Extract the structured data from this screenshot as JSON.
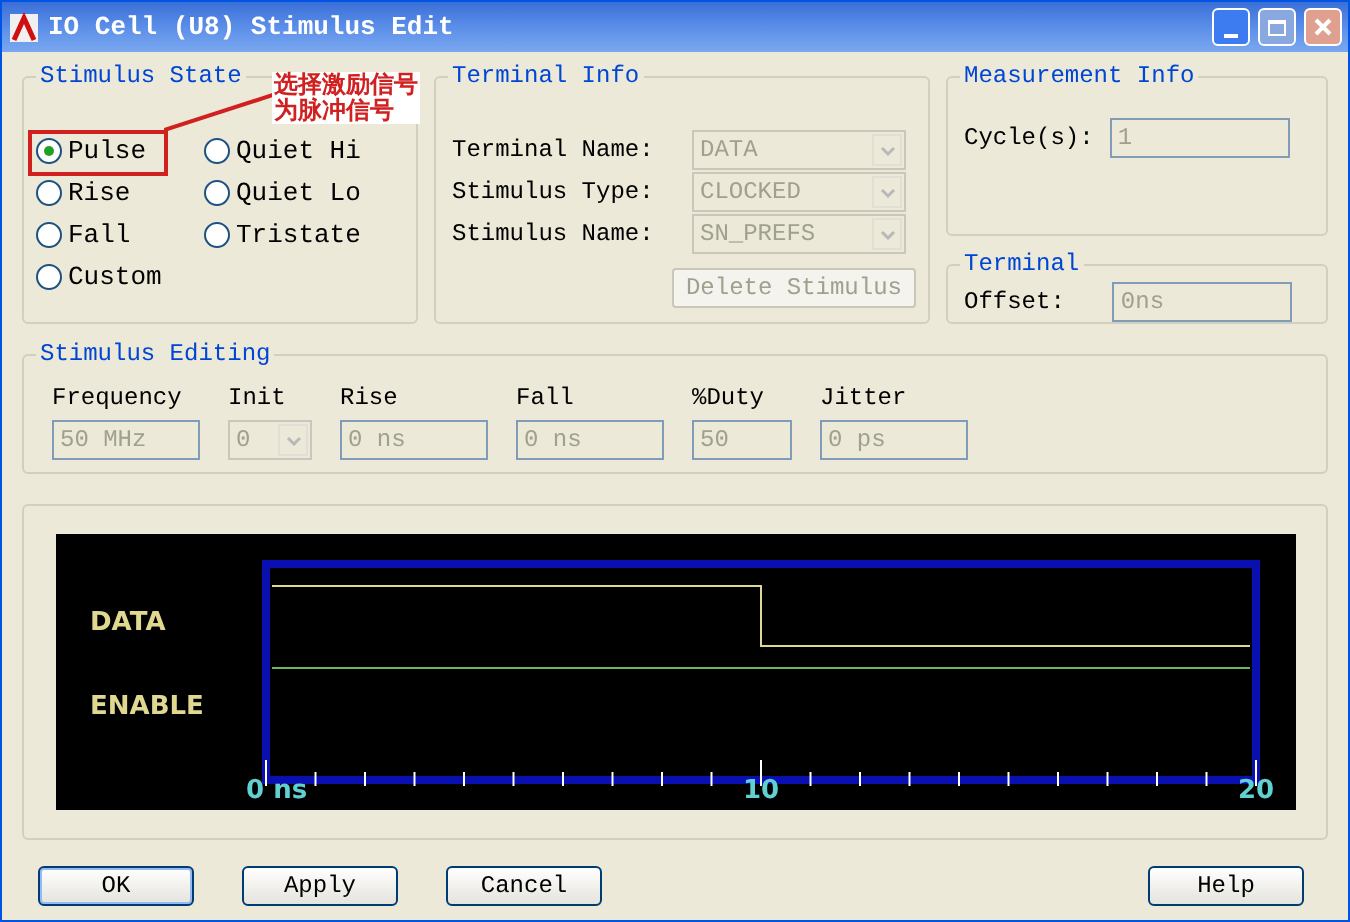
{
  "window": {
    "title": "IO Cell (U8) Stimulus Edit"
  },
  "stimulus_state": {
    "legend": "Stimulus State",
    "options": [
      {
        "label": "Pulse",
        "selected": true
      },
      {
        "label": "Quiet Hi",
        "selected": false
      },
      {
        "label": "Rise",
        "selected": false
      },
      {
        "label": "Quiet Lo",
        "selected": false
      },
      {
        "label": "Fall",
        "selected": false
      },
      {
        "label": "Tristate",
        "selected": false
      },
      {
        "label": "Custom",
        "selected": false
      }
    ]
  },
  "annotation": {
    "lines": [
      "选择激励信号",
      "为脉冲信号"
    ]
  },
  "terminal_info": {
    "legend": "Terminal Info",
    "fields": [
      {
        "label": "Terminal Name:",
        "value": "DATA"
      },
      {
        "label": "Stimulus Type:",
        "value": "CLOCKED"
      },
      {
        "label": "Stimulus Name:",
        "value": "SN_PREFS"
      }
    ],
    "delete_button": {
      "label": "Delete Stimulus",
      "disabled": true
    }
  },
  "measurement_info": {
    "legend": "Measurement Info",
    "field": {
      "label": "Cycle(s):",
      "value": "1"
    }
  },
  "terminal": {
    "legend": "Terminal",
    "field": {
      "label": "Offset:",
      "value": "0ns"
    }
  },
  "stimulus_editing": {
    "legend": "Stimulus Editing",
    "fields": [
      {
        "label": "Frequency",
        "value": "50 MHz",
        "kind": "text"
      },
      {
        "label": "Init",
        "value": "0",
        "kind": "select"
      },
      {
        "label": "Rise",
        "value": "0 ns",
        "kind": "text"
      },
      {
        "label": "Fall",
        "value": "0 ns",
        "kind": "text"
      },
      {
        "label": "%Duty",
        "value": "50",
        "kind": "short"
      },
      {
        "label": "Jitter",
        "value": "0 ps",
        "kind": "text"
      }
    ]
  },
  "waveform": {
    "signals": [
      "DATA",
      "ENABLE"
    ],
    "ticks": [
      "0 ns",
      "10",
      "20"
    ]
  },
  "buttons": [
    "OK",
    "Apply",
    "Cancel",
    "Help"
  ]
}
